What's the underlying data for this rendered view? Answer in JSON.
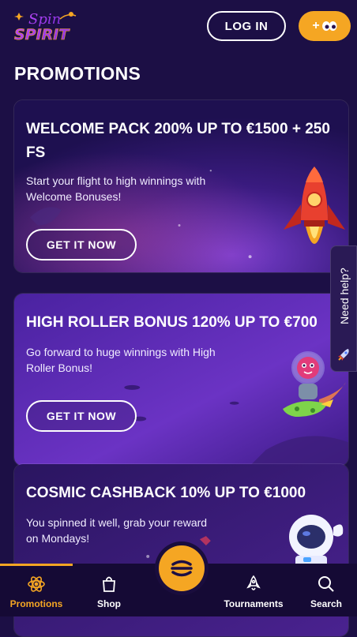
{
  "header": {
    "logo_text": "Spin SPIRIT",
    "login_label": "LOG IN",
    "signup_symbol": "+",
    "signup_icon": "eyes-icon"
  },
  "page_title": "PROMOTIONS",
  "promotions": [
    {
      "title": "WELCOME PACK 200% UP TO €1500 + 250 FS",
      "description": "Start your flight to high winnings with Welcome Bonuses!",
      "button": "GET IT NOW",
      "art": "rocket"
    },
    {
      "title": "HIGH ROLLER BONUS 120% UP TO €700",
      "description": "Go forward to huge winnings with High Roller Bonus!",
      "button": "GET IT NOW",
      "art": "alien-astronaut"
    },
    {
      "title": "COSMIC CASHBACK 10% UP TO €1000",
      "description": "You spinned it well, grab your reward on Mondays!",
      "art": "astronaut"
    }
  ],
  "need_help": "Need help?",
  "bottom_nav": {
    "items": [
      {
        "label": "Promotions",
        "icon": "atom-icon",
        "active": true
      },
      {
        "label": "Shop",
        "icon": "shopping-bag-icon",
        "active": false
      },
      {
        "label": "Tournaments",
        "icon": "rocket-icon",
        "active": false
      },
      {
        "label": "Search",
        "icon": "search-icon",
        "active": false
      }
    ],
    "center_icon": "menu-icon"
  },
  "colors": {
    "background": "#1c0f45",
    "accent": "#f5a623",
    "nav_background": "#150a35",
    "card_purple": "#5a2fa8"
  }
}
